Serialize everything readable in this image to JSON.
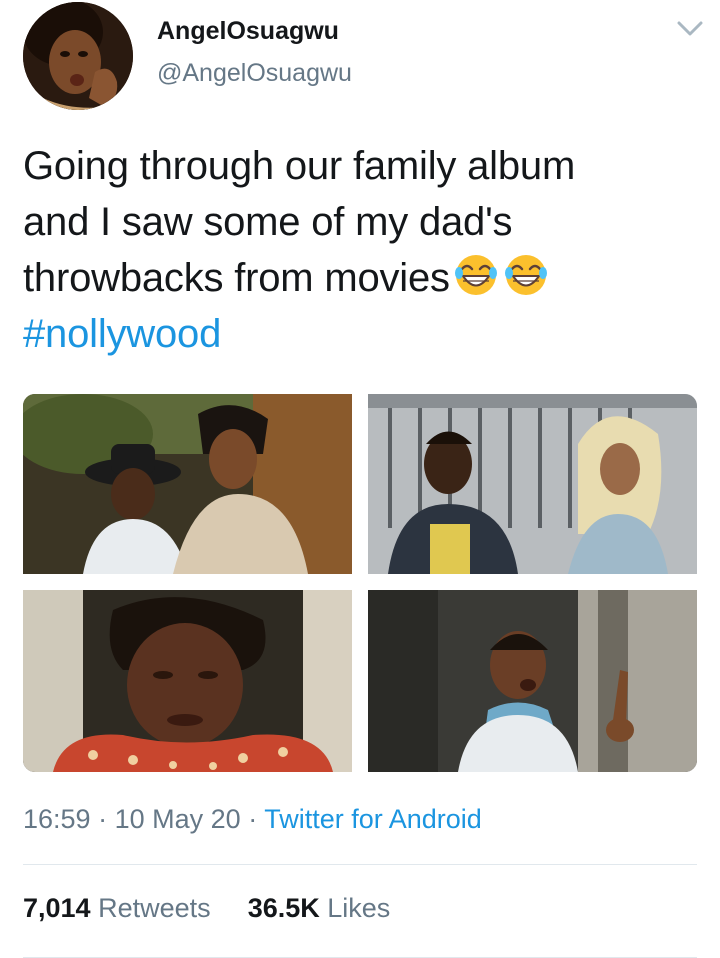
{
  "author": {
    "display_name": "AngelOsuagwu",
    "handle": "@AngelOsuagwu",
    "avatar_icon": "profile-photo"
  },
  "tweet": {
    "lines": [
      "Going through our family album",
      "and I saw some of my dad's",
      "throwbacks from movies"
    ],
    "emoji": [
      "😂",
      "😂"
    ],
    "hashtag": "#nollywood"
  },
  "media": {
    "count": 4,
    "photos": [
      "photo-1",
      "photo-2",
      "photo-3",
      "photo-4"
    ]
  },
  "meta": {
    "time": "16:59",
    "separator": "·",
    "date": "10 May 20",
    "source": "Twitter for Android"
  },
  "stats": {
    "retweets_count": "7,014",
    "retweets_label": "Retweets",
    "likes_count": "36.5K",
    "likes_label": "Likes"
  },
  "colors": {
    "link": "#1b95e0",
    "secondary": "#657786",
    "primary": "#14171a",
    "divider": "#e1e8ed"
  }
}
